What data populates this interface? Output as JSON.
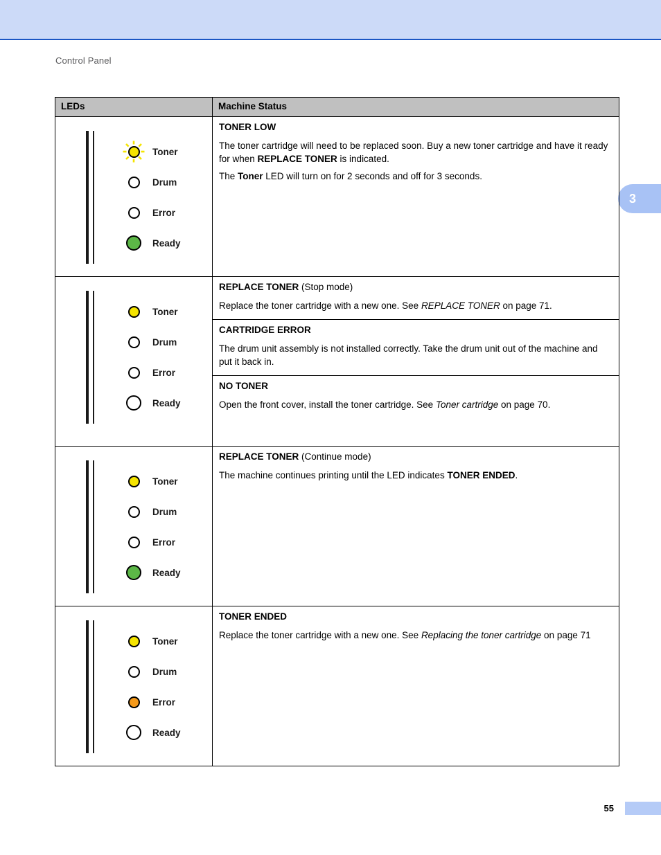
{
  "page": {
    "running_head": "Control Panel",
    "chapter_tab": "3",
    "page_number": "55",
    "accent_band": "#ccdaf8",
    "accent_rule": "#1b56c4",
    "tab_color": "#a8c2f5"
  },
  "table": {
    "headers": {
      "leds": "LEDs",
      "status": "Machine Status"
    },
    "led_names": {
      "toner": "Toner",
      "drum": "Drum",
      "error": "Error",
      "ready": "Ready"
    },
    "colors": {
      "yellow": "#f5e400",
      "green": "#5cb747",
      "orange": "#f59a1b",
      "off": "#ffffff",
      "header_fill": "#c0c0c0"
    },
    "rows": [
      {
        "leds": [
          {
            "name": "Toner",
            "state": "blinking-yellow"
          },
          {
            "name": "Drum",
            "state": "off"
          },
          {
            "name": "Error",
            "state": "off"
          },
          {
            "name": "Ready",
            "state": "green"
          }
        ],
        "blocks": [
          {
            "title": "TONER LOW",
            "title_suffix": "",
            "paragraphs": [
              "The toner cartridge will need to be replaced soon. Buy a new toner cartridge and have it ready for when REPLACE TONER is indicated.",
              "The Toner LED will turn on for 2 seconds and off for 3 seconds."
            ]
          }
        ]
      },
      {
        "leds": [
          {
            "name": "Toner",
            "state": "yellow"
          },
          {
            "name": "Drum",
            "state": "off"
          },
          {
            "name": "Error",
            "state": "off"
          },
          {
            "name": "Ready",
            "state": "off-big"
          }
        ],
        "blocks": [
          {
            "title": "REPLACE TONER",
            "title_suffix": " (Stop mode)",
            "paragraphs": [
              "Replace the toner cartridge with a new one. See REPLACE TONER on page 71."
            ]
          },
          {
            "title": "CARTRIDGE ERROR",
            "title_suffix": "",
            "paragraphs": [
              "The drum unit assembly is not installed correctly. Take the drum unit out of the machine and put it back in."
            ]
          },
          {
            "title": "NO TONER",
            "title_suffix": "",
            "paragraphs": [
              "Open the front cover, install the toner cartridge. See Toner cartridge on page 70."
            ]
          }
        ]
      },
      {
        "leds": [
          {
            "name": "Toner",
            "state": "yellow"
          },
          {
            "name": "Drum",
            "state": "off"
          },
          {
            "name": "Error",
            "state": "off"
          },
          {
            "name": "Ready",
            "state": "green"
          }
        ],
        "blocks": [
          {
            "title": "REPLACE TONER",
            "title_suffix": " (Continue mode)",
            "paragraphs": [
              "The machine continues printing until the LED indicates TONER ENDED."
            ]
          }
        ]
      },
      {
        "leds": [
          {
            "name": "Toner",
            "state": "yellow"
          },
          {
            "name": "Drum",
            "state": "off"
          },
          {
            "name": "Error",
            "state": "orange"
          },
          {
            "name": "Ready",
            "state": "off-big"
          }
        ],
        "blocks": [
          {
            "title": "TONER ENDED",
            "title_suffix": "",
            "paragraphs": [
              "Replace the toner cartridge with a new one. See Replacing the toner cartridge on page 71"
            ]
          }
        ]
      }
    ]
  },
  "r1": {
    "title": "TONER LOW",
    "p1_a": "The toner cartridge will need to be replaced soon. Buy a new toner cartridge and have it ready for when ",
    "p1_b": "REPLACE TONER",
    "p1_c": " is indicated.",
    "p2_a": "The ",
    "p2_b": "Toner",
    "p2_c": " LED will turn on for 2 seconds and off for 3 seconds."
  },
  "r2a": {
    "title": "REPLACE TONER",
    "suffix": " (Stop mode)",
    "p1_a": "Replace the toner cartridge with a new one. See ",
    "p1_b": "REPLACE TONER",
    "p1_c": " on page 71."
  },
  "r2b": {
    "title": "CARTRIDGE ERROR",
    "p1": "The drum unit assembly is not installed correctly. Take the drum unit out of the machine and put it back in."
  },
  "r2c": {
    "title": "NO TONER",
    "p1_a": "Open the front cover, install the toner cartridge. See ",
    "p1_b": "Toner cartridge",
    "p1_c": " on page 70."
  },
  "r3": {
    "title": "REPLACE TONER",
    "suffix": " (Continue mode)",
    "p1_a": "The machine continues printing until the LED indicates ",
    "p1_b": "TONER ENDED",
    "p1_c": "."
  },
  "r4": {
    "title": "TONER ENDED",
    "p1_a": "Replace the toner cartridge with a new one. See ",
    "p1_b": "Replacing the toner cartridge",
    "p1_c": " on page 71"
  }
}
